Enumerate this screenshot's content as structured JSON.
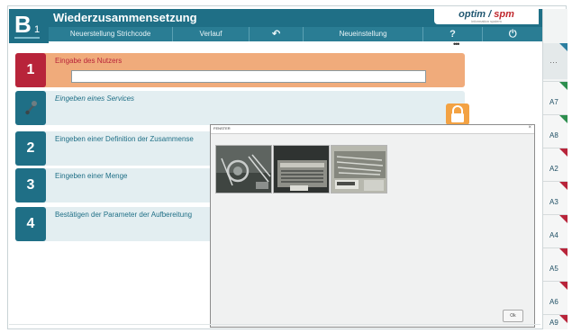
{
  "header": {
    "logo_letter": "B",
    "logo_index": "1",
    "title": "Wiederzusammensetzung",
    "brand_name_1": "optim",
    "brand_sep": " / ",
    "brand_name_2": "spm",
    "brand_tagline": "information system"
  },
  "menu": {
    "items": [
      {
        "label": "Neuerstellung Strichcode"
      },
      {
        "label": "Verlauf"
      },
      {
        "label": "↶"
      },
      {
        "label": "Neueinstellung"
      },
      {
        "label": "?"
      },
      {
        "label": "⏻"
      }
    ]
  },
  "more_dots": "•••",
  "steps": [
    {
      "number": "1",
      "label": "Eingabe des Nutzers",
      "input_value": ""
    },
    {
      "number": "",
      "label": "Eingeben eines Services",
      "icon": "wrench-icon"
    },
    {
      "number": "2",
      "label": "Eingeben einer Definition der Zusammense"
    },
    {
      "number": "3",
      "label": "Eingeben einer Menge"
    },
    {
      "number": "4",
      "label": "Bestätigen der Parameter der Aufbereitung"
    }
  ],
  "sidebar": {
    "top_dots": "···",
    "tabs": [
      {
        "label": "A7",
        "flag_color": "#2d8e4e"
      },
      {
        "label": "A8",
        "flag_color": "#2d8e4e"
      },
      {
        "label": "A2",
        "flag_color": "#b8243a"
      },
      {
        "label": "A3",
        "flag_color": "#b8243a"
      },
      {
        "label": "A4",
        "flag_color": "#b8243a"
      },
      {
        "label": "A5",
        "flag_color": "#b8243a"
      },
      {
        "label": "A6",
        "flag_color": "#b8243a"
      },
      {
        "label": "A9",
        "flag_color": "#b8243a"
      }
    ]
  },
  "popup": {
    "title": "FENSTER",
    "close": "×",
    "ok_label": "Ok",
    "images": [
      {
        "name": "instrument-tray-image"
      },
      {
        "name": "instrument-box-image"
      },
      {
        "name": "surgical-set-image"
      }
    ]
  },
  "colors": {
    "primary": "#1f6f86",
    "active_step": "#f0ab7b",
    "active_number": "#b8243a",
    "lock": "#f3a243"
  }
}
